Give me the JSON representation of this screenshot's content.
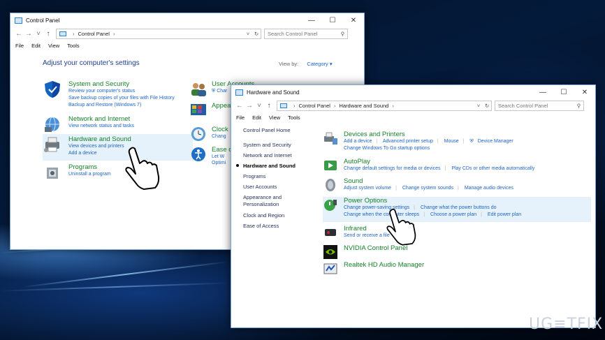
{
  "watermark": "UG≡TFIX",
  "win1": {
    "title": "Control Panel",
    "window_controls": [
      "minimize",
      "maximize",
      "close"
    ],
    "breadcrumb": [
      "Control Panel"
    ],
    "search_placeholder": "Search Control Panel",
    "menu": [
      "File",
      "Edit",
      "View",
      "Tools"
    ],
    "heading": "Adjust your computer's settings",
    "view_by_label": "View by:",
    "view_by_value": "Category",
    "categories_left": [
      {
        "title": "System and Security",
        "icon": "shield-icon",
        "links": [
          "Review your computer's status",
          "Save backup copies of your files with File History",
          "Backup and Restore (Windows 7)"
        ]
      },
      {
        "title": "Network and Internet",
        "icon": "globe-icon",
        "links": [
          "View network status and tasks"
        ]
      },
      {
        "title": "Hardware and Sound",
        "icon": "printer-icon",
        "links": [
          "View devices and printers",
          "Add a device"
        ]
      },
      {
        "title": "Programs",
        "icon": "programs-icon",
        "links": [
          "Uninstall a program"
        ]
      }
    ],
    "categories_right": [
      {
        "title": "User Accounts",
        "links": [
          "Char"
        ]
      },
      {
        "title": "Appea",
        "links": []
      },
      {
        "title": "Clock",
        "links": [
          "Chang"
        ]
      },
      {
        "title": "Ease o",
        "links": [
          "Let W",
          "Optimi"
        ]
      }
    ]
  },
  "win2": {
    "title": "Hardware and Sound",
    "breadcrumb": [
      "Control Panel",
      "Hardware and Sound"
    ],
    "search_placeholder": "Search Control Panel",
    "menu": [
      "File",
      "Edit",
      "View",
      "Tools"
    ],
    "sidebar": [
      "Control Panel Home",
      "System and Security",
      "Network and Internet",
      "Hardware and Sound",
      "Programs",
      "User Accounts",
      "Appearance and Personalization",
      "Clock and Region",
      "Ease of Access"
    ],
    "sections": [
      {
        "title": "Devices and Printers",
        "icon": "devices-printers-icon",
        "lines": [
          [
            "Add a device",
            "Advanced printer setup",
            "Mouse",
            "Device Manager"
          ],
          [
            "Change Windows To Go startup options"
          ]
        ]
      },
      {
        "title": "AutoPlay",
        "icon": "autoplay-icon",
        "lines": [
          [
            "Change default settings for media or devices",
            "Play CDs or other media automatically"
          ]
        ]
      },
      {
        "title": "Sound",
        "icon": "speaker-icon",
        "lines": [
          [
            "Adjust system volume",
            "Change system sounds",
            "Manage audio devices"
          ]
        ]
      },
      {
        "title": "Power Options",
        "icon": "battery-icon",
        "lines": [
          [
            "Change power-saving settings",
            "Change what the power buttons do"
          ],
          [
            "Change when the computer sleeps",
            "Choose a power plan",
            "Edit power plan"
          ]
        ]
      },
      {
        "title": "Infrared",
        "icon": "infrared-icon",
        "lines": [
          [
            "Send or receive a file"
          ]
        ]
      },
      {
        "title": "NVIDIA Control Panel",
        "icon": "nvidia-icon",
        "lines": []
      },
      {
        "title": "Realtek HD Audio Manager",
        "icon": "realtek-icon",
        "lines": []
      }
    ]
  }
}
